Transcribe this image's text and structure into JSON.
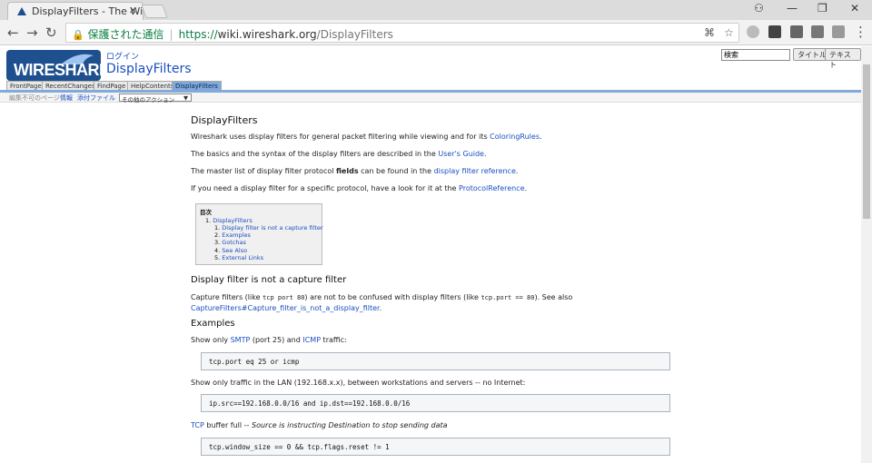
{
  "browser": {
    "tab_title": "DisplayFilters - The Wiresh",
    "tab_close": "✕",
    "window_controls": [
      "⚇",
      "—",
      "❐",
      "✕"
    ],
    "secure_label": "保護された通信",
    "url_scheme": "https://",
    "url_host": "wiki.wireshark.org",
    "url_path": "/DisplayFilters"
  },
  "site": {
    "logo": "WIRESHARK",
    "login": "ログイン",
    "title": "DisplayFilters",
    "search_placeholder": "検索",
    "title_button": "タイトル",
    "text_button": "テキスト",
    "nav_tabs": [
      {
        "label": "FrontPage"
      },
      {
        "label": "RecentChanges"
      },
      {
        "label": "FindPage"
      },
      {
        "label": "HelpContents"
      },
      {
        "label": "DisplayFilters"
      }
    ],
    "actions": {
      "uneditable": "編集不可のページ",
      "info": "情報",
      "attachments": "添付ファイル",
      "more_actions": "その他のアクション"
    }
  },
  "content": {
    "h1": "DisplayFilters",
    "p1": {
      "text": "Wireshark uses display filters for general packet filtering while viewing and for its ",
      "link": "ColoringRules",
      "tail": "."
    },
    "p2": {
      "text": "The basics and the syntax of the display filters are described in the ",
      "link": "User's Guide",
      "tail": "."
    },
    "p3": {
      "pre": "The master list of display filter protocol ",
      "bold": "fields",
      "mid": " can be found in the ",
      "link": "display filter reference",
      "tail": "."
    },
    "p4": {
      "text": "If you need a display filter for a specific protocol, have a look for it at the ",
      "link": "ProtocolReference",
      "tail": "."
    },
    "toc": {
      "title": "目次",
      "items": [
        {
          "num": "1.",
          "label": "DisplayFilters"
        },
        {
          "num": "1.",
          "label": "Display filter is not a capture filter"
        },
        {
          "num": "2.",
          "label": "Examples"
        },
        {
          "num": "3.",
          "label": "Gotchas"
        },
        {
          "num": "4.",
          "label": "See Also"
        },
        {
          "num": "5.",
          "label": "External Links"
        }
      ]
    },
    "h2_capture": "Display filter is not a capture filter",
    "capture_para": {
      "a": "Capture filters (like ",
      "code1": "tcp port 80",
      "b": ") are not to be confused with display filters (like ",
      "code2": "tcp.port == 80",
      "c": "). See also",
      "link": "CaptureFilters#Capture_filter_is_not_a_display_filter",
      "tail": "."
    },
    "h2_examples": "Examples",
    "ex1": {
      "a": "Show only ",
      "link1": "SMTP",
      "b": " (port 25) and ",
      "link2": "ICMP",
      "c": " traffic:"
    },
    "code1": "tcp.port eq 25 or icmp",
    "ex2": "Show only traffic in the LAN (192.168.x.x), between workstations and servers -- no Internet:",
    "code2": "ip.src==192.168.0.0/16 and ip.dst==192.168.0.0/16",
    "ex3": {
      "link": "TCP",
      "b": " buffer full -- ",
      "italic": "Source is instructing Destination to stop sending data"
    },
    "code3": "tcp.window_size == 0 && tcp.flags.reset != 1"
  }
}
